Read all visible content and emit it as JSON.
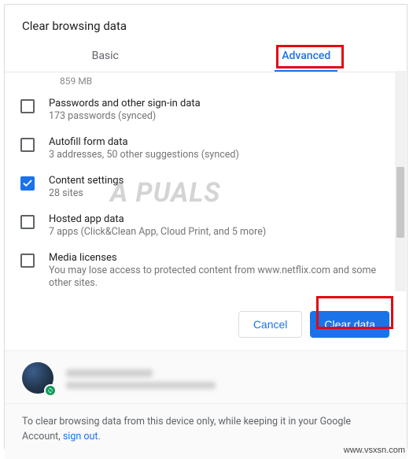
{
  "dialog": {
    "title": "Clear browsing data",
    "truncated_prev_sub": "859 MB"
  },
  "tabs": {
    "basic": "Basic",
    "advanced": "Advanced"
  },
  "items": [
    {
      "checked": false,
      "title": "Passwords and other sign-in data",
      "sub": "173 passwords (synced)"
    },
    {
      "checked": false,
      "title": "Autofill form data",
      "sub": "3 addresses, 50 other suggestions (synced)"
    },
    {
      "checked": true,
      "title": "Content settings",
      "sub": "28 sites"
    },
    {
      "checked": false,
      "title": "Hosted app data",
      "sub": "7 apps (Click&Clean App, Cloud Print, and 5 more)"
    },
    {
      "checked": false,
      "title": "Media licenses",
      "sub": "You may lose access to protected content from www.netflix.com and some other sites."
    }
  ],
  "actions": {
    "cancel": "Cancel",
    "clear": "Clear data"
  },
  "footer": {
    "text_before": "To clear browsing data from this device only, while keeping it in your Google Account, ",
    "link": "sign out",
    "text_after": "."
  },
  "watermark": "A PUALS",
  "source": "www.vsxsn.com"
}
